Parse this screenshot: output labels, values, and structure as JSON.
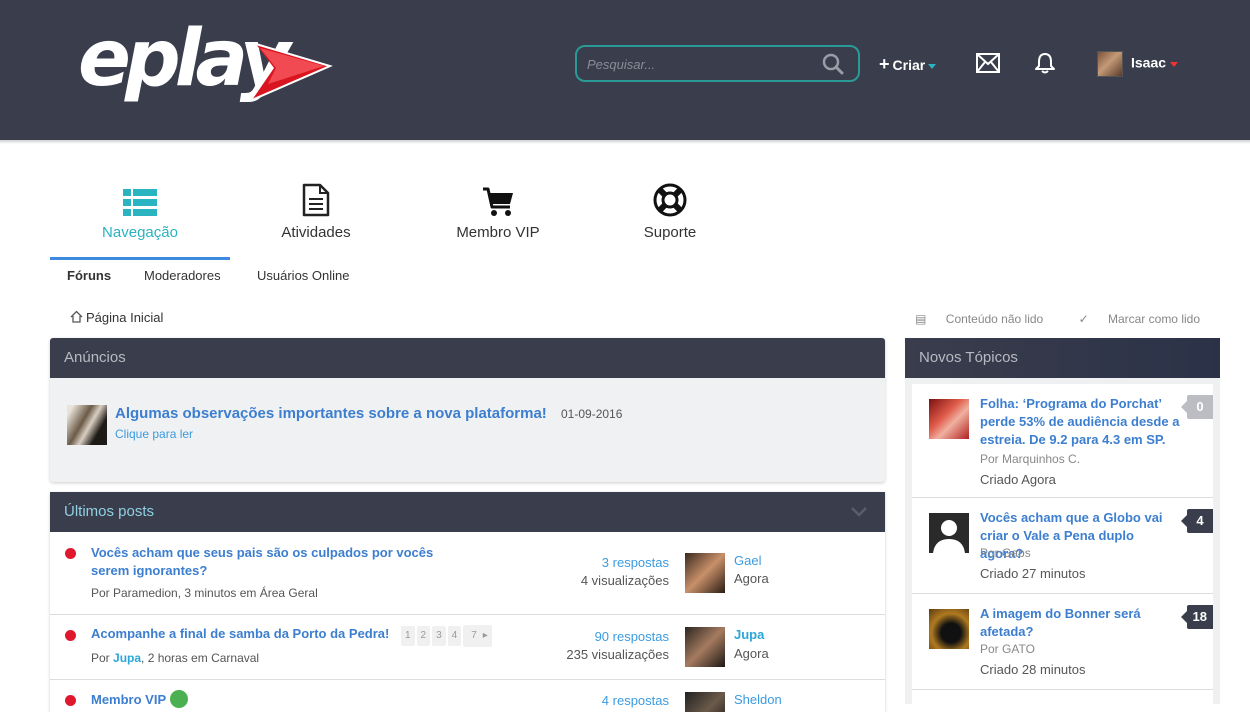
{
  "header": {
    "brand": "eplay",
    "search_placeholder": "Pesquisar...",
    "criar_label": "Criar",
    "user_name": "Isaac"
  },
  "tabs": [
    {
      "label": "Navegação",
      "icon": "list-icon",
      "active": true
    },
    {
      "label": "Atividades",
      "icon": "document-icon",
      "active": false
    },
    {
      "label": "Membro VIP",
      "icon": "cart-icon",
      "active": false
    },
    {
      "label": "Suporte",
      "icon": "lifebuoy-icon",
      "active": false
    }
  ],
  "subtabs": [
    {
      "label": "Fóruns",
      "active": true
    },
    {
      "label": "Moderadores",
      "active": false
    },
    {
      "label": "Usuários Online",
      "active": false
    }
  ],
  "breadcrumb": {
    "home": "Página Inicial"
  },
  "tools": {
    "unread": "Conteúdo não lido",
    "mark_read": "Marcar como lido"
  },
  "announcements": {
    "title": "Anúncios",
    "item": {
      "title": "Algumas observações importantes sobre a nova plataforma!",
      "date": "01-09-2016",
      "link": "Clique para ler"
    }
  },
  "latest_posts": {
    "title": "Últimos posts",
    "rows": [
      {
        "title": "Vocês acham que seus pais são os culpados por vocês serem ignorantes?",
        "meta_prefix": "Por Paramedion, 3 minutos em Área Geral",
        "replies": "3 respostas",
        "views": "4 visualizações",
        "last_user": "Gael",
        "last_time": "Agora"
      },
      {
        "title": "Acompanhe a final de samba da Porto da Pedra!",
        "pages": [
          "1",
          "2",
          "3",
          "4",
          "7"
        ],
        "meta_by": "Por ",
        "meta_user": "Jupa",
        "meta_rest": ", 2 horas em Carnaval",
        "replies": "90 respostas",
        "views": "235 visualizações",
        "last_user": "Jupa",
        "last_time": "Agora"
      },
      {
        "title": "Membro VIP",
        "replies": "4 respostas",
        "last_user": "Sheldon"
      }
    ]
  },
  "new_topics": {
    "title": "Novos Tópicos",
    "items": [
      {
        "title": "Folha: ‘Programa do Porchat’ perde 53% de audiência desde a estreia. De 9.2 para 4.3 em SP.",
        "by": "Por Marquinhos C.",
        "when": "Criado Agora",
        "count": "0"
      },
      {
        "title": "Vocês acham que a Globo vai criar o Vale a Pena duplo agora?",
        "by": "Por Gabs",
        "when": "Criado 27 minutos",
        "count": "4"
      },
      {
        "title": "A imagem do Bonner será afetada?",
        "by": "Por GATO",
        "when": "Criado 28 minutos",
        "count": "18"
      }
    ]
  },
  "colors": {
    "header_bg": "#3a3d4c",
    "accent_teal": "#2ab3c0",
    "link_blue": "#3c7ecf",
    "unread_red": "#e0182d"
  }
}
